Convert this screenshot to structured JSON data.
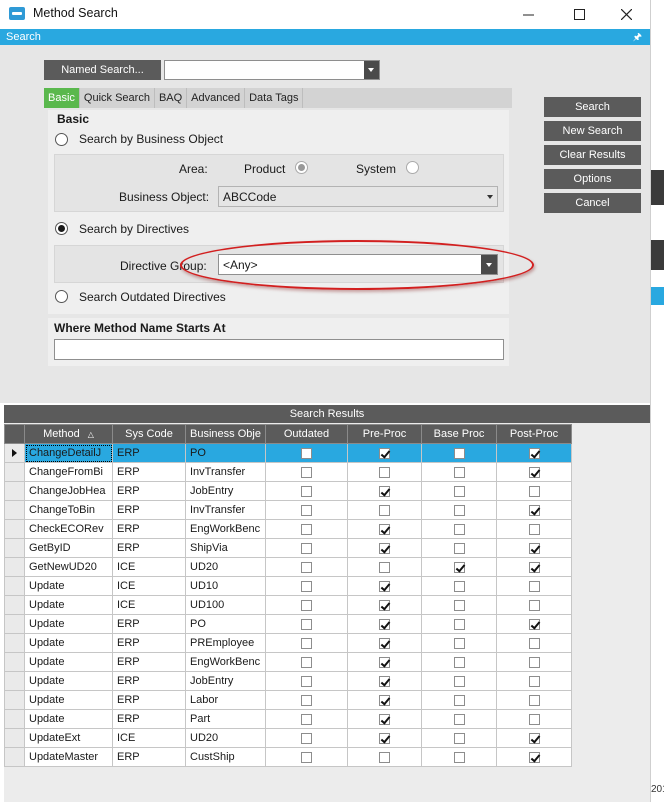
{
  "window": {
    "title": "Method Search",
    "minimize_icon": "minimize-icon",
    "maximize_icon": "maximize-icon",
    "close_icon": "close-icon",
    "edge_year": "201"
  },
  "search_bar": {
    "label": "Search",
    "pin_icon": "pin-icon"
  },
  "named_search": {
    "button_label": "Named Search...",
    "value": ""
  },
  "tabs": [
    {
      "label": "Basic",
      "active": true
    },
    {
      "label": "Quick Search",
      "active": false
    },
    {
      "label": "BAQ",
      "active": false
    },
    {
      "label": "Advanced",
      "active": false
    },
    {
      "label": "Data Tags",
      "active": false
    }
  ],
  "basic": {
    "title": "Basic",
    "search_by_business_object": "Search by Business Object",
    "area_label": "Area:",
    "area_product": "Product",
    "area_system": "System",
    "business_object_label": "Business Object:",
    "business_object_value": "ABCCode",
    "search_by_directives": "Search by Directives",
    "directive_group_label": "Directive Group:",
    "directive_group_value": "<Any>",
    "search_outdated": "Search Outdated Directives",
    "selected_mode": "Search by Directives"
  },
  "where": {
    "title": "Where Method Name Starts At",
    "value": ""
  },
  "actions": {
    "search": "Search",
    "new_search": "New Search",
    "clear_results": "Clear Results",
    "options": "Options",
    "cancel": "Cancel"
  },
  "results": {
    "title": "Search Results",
    "columns": [
      "Method",
      "Sys Code",
      "Business Obje",
      "Outdated",
      "Pre-Proc",
      "Base Proc",
      "Post-Proc"
    ],
    "sort_icon": "sort-ascending-icon",
    "rows": [
      {
        "method": "ChangeDetailJ",
        "sys": "ERP",
        "bo": "PO",
        "outdated": false,
        "pre": true,
        "base": false,
        "post": true,
        "selected": true
      },
      {
        "method": "ChangeFromBi",
        "sys": "ERP",
        "bo": "InvTransfer",
        "outdated": false,
        "pre": false,
        "base": false,
        "post": true
      },
      {
        "method": "ChangeJobHea",
        "sys": "ERP",
        "bo": "JobEntry",
        "outdated": false,
        "pre": true,
        "base": false,
        "post": false
      },
      {
        "method": "ChangeToBin",
        "sys": "ERP",
        "bo": "InvTransfer",
        "outdated": false,
        "pre": false,
        "base": false,
        "post": true
      },
      {
        "method": "CheckECORev",
        "sys": "ERP",
        "bo": "EngWorkBenc",
        "outdated": false,
        "pre": true,
        "base": false,
        "post": false
      },
      {
        "method": "GetByID",
        "sys": "ERP",
        "bo": "ShipVia",
        "outdated": false,
        "pre": true,
        "base": false,
        "post": true
      },
      {
        "method": "GetNewUD20",
        "sys": "ICE",
        "bo": "UD20",
        "outdated": false,
        "pre": false,
        "base": true,
        "post": true
      },
      {
        "method": "Update",
        "sys": "ICE",
        "bo": "UD10",
        "outdated": false,
        "pre": true,
        "base": false,
        "post": false
      },
      {
        "method": "Update",
        "sys": "ICE",
        "bo": "UD100",
        "outdated": false,
        "pre": true,
        "base": false,
        "post": false
      },
      {
        "method": "Update",
        "sys": "ERP",
        "bo": "PO",
        "outdated": false,
        "pre": true,
        "base": false,
        "post": true
      },
      {
        "method": "Update",
        "sys": "ERP",
        "bo": "PREmployee",
        "outdated": false,
        "pre": true,
        "base": false,
        "post": false
      },
      {
        "method": "Update",
        "sys": "ERP",
        "bo": "EngWorkBenc",
        "outdated": false,
        "pre": true,
        "base": false,
        "post": false
      },
      {
        "method": "Update",
        "sys": "ERP",
        "bo": "JobEntry",
        "outdated": false,
        "pre": true,
        "base": false,
        "post": false
      },
      {
        "method": "Update",
        "sys": "ERP",
        "bo": "Labor",
        "outdated": false,
        "pre": true,
        "base": false,
        "post": false
      },
      {
        "method": "Update",
        "sys": "ERP",
        "bo": "Part",
        "outdated": false,
        "pre": true,
        "base": false,
        "post": false
      },
      {
        "method": "UpdateExt",
        "sys": "ICE",
        "bo": "UD20",
        "outdated": false,
        "pre": true,
        "base": false,
        "post": true
      },
      {
        "method": "UpdateMaster",
        "sys": "ERP",
        "bo": "CustShip",
        "outdated": false,
        "pre": false,
        "base": false,
        "post": true
      }
    ]
  }
}
